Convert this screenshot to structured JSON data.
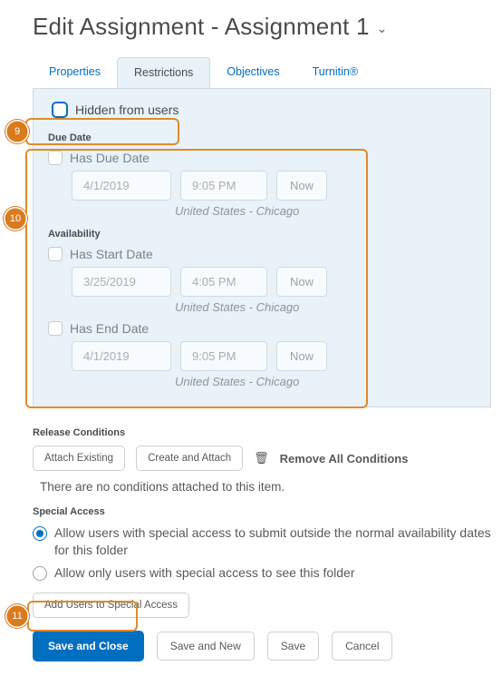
{
  "title": "Edit Assignment - Assignment 1",
  "tabs": {
    "properties": "Properties",
    "restrictions": "Restrictions",
    "objectives": "Objectives",
    "turnitin": "Turnitin®"
  },
  "annotations": {
    "a9": "9",
    "a10": "10",
    "a11": "11"
  },
  "hidden": {
    "label": "Hidden from users"
  },
  "due": {
    "heading": "Due Date",
    "has": "Has Due Date",
    "date": "4/1/2019",
    "time": "9:05 PM",
    "now": "Now",
    "tz": "United States - Chicago"
  },
  "avail": {
    "heading": "Availability",
    "hasStart": "Has Start Date",
    "startDate": "3/25/2019",
    "startTime": "4:05 PM",
    "hasEnd": "Has End Date",
    "endDate": "4/1/2019",
    "endTime": "9:05 PM",
    "now": "Now",
    "tz": "United States - Chicago"
  },
  "release": {
    "heading": "Release Conditions",
    "attach": "Attach Existing",
    "create": "Create and Attach",
    "remove": "Remove All Conditions",
    "empty": "There are no conditions attached to this item."
  },
  "special": {
    "heading": "Special Access",
    "opt1": "Allow users with special access to submit outside the normal availability dates for this folder",
    "opt2": "Allow only users with special access to see this folder",
    "add": "Add Users to Special Access"
  },
  "footer": {
    "saveClose": "Save and Close",
    "saveNew": "Save and New",
    "save": "Save",
    "cancel": "Cancel"
  }
}
